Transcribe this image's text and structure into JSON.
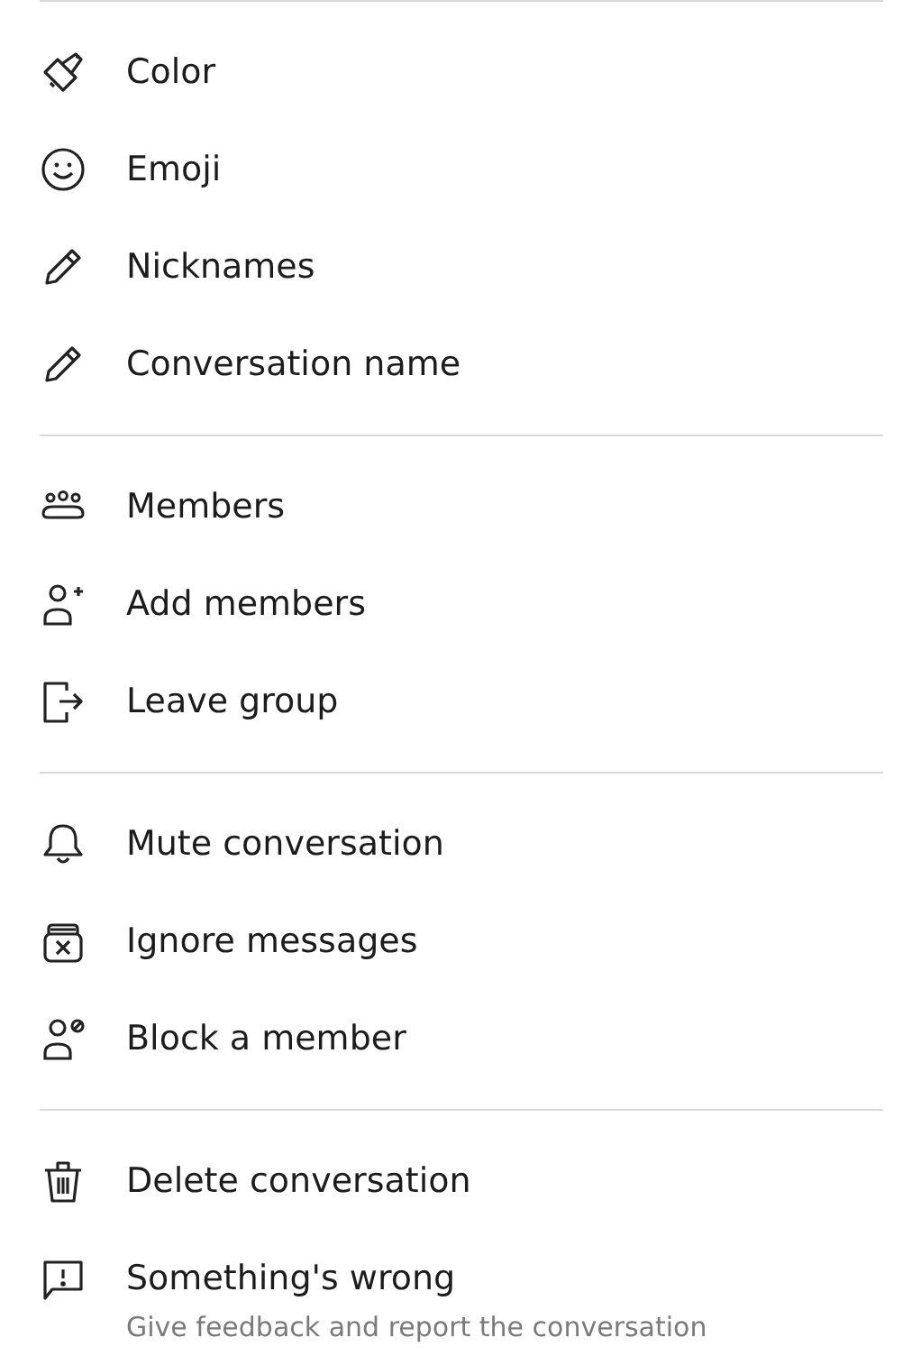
{
  "sections": [
    {
      "items": [
        {
          "label": "Color"
        },
        {
          "label": "Emoji"
        },
        {
          "label": "Nicknames"
        },
        {
          "label": "Conversation name"
        }
      ]
    },
    {
      "items": [
        {
          "label": "Members"
        },
        {
          "label": "Add members"
        },
        {
          "label": "Leave group"
        }
      ]
    },
    {
      "items": [
        {
          "label": "Mute conversation"
        },
        {
          "label": "Ignore messages"
        },
        {
          "label": "Block a member"
        }
      ]
    },
    {
      "items": [
        {
          "label": "Delete conversation"
        },
        {
          "label": "Something's wrong",
          "description": "Give feedback and report the conversation"
        }
      ]
    }
  ]
}
